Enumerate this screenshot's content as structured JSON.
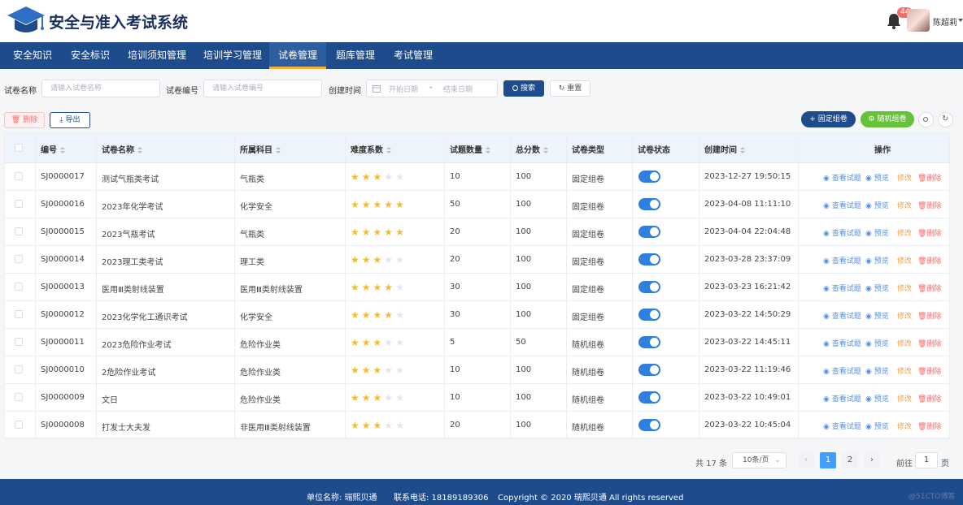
{
  "header": {
    "title": "安全与准入考试系统",
    "notification_count": "44",
    "username": "陈超莉"
  },
  "nav": [
    "安全知识",
    "安全标识",
    "培训须知管理",
    "培训学习管理",
    "试卷管理",
    "题库管理",
    "考试管理"
  ],
  "nav_active": "试卷管理",
  "filters": {
    "name_label": "试卷名称",
    "name_placeholder": "请输入试卷名称",
    "code_label": "试卷编号",
    "code_placeholder": "请输入试卷编号",
    "date_label": "创建时间",
    "start_placeholder": "开始日期",
    "separator": "-",
    "end_placeholder": "结束日期",
    "search": "搜索",
    "reset": "重置"
  },
  "toolbar": {
    "delete": "删除",
    "export": "导出",
    "fixed": "固定组卷",
    "random": "随机组卷"
  },
  "columns": {
    "code": "编号",
    "name": "试卷名称",
    "subject": "所属科目",
    "difficulty": "难度系数",
    "count": "试题数量",
    "score": "总分数",
    "type": "试卷类型",
    "status": "试卷状态",
    "created": "创建时间",
    "ops": "操作"
  },
  "actions": {
    "view": "查看试题",
    "preview": "预览",
    "edit": "修改",
    "delete": "删除"
  },
  "rows": [
    {
      "code": "SJ0000017",
      "name": "测试气瓶类考试",
      "subject": "气瓶类",
      "difficulty": 3,
      "count": "10",
      "score": "100",
      "type": "固定组卷",
      "status": true,
      "created": "2023-12-27 19:50:15"
    },
    {
      "code": "SJ0000016",
      "name": "2023年化学考试",
      "subject": "化学安全",
      "difficulty": 5,
      "count": "50",
      "score": "100",
      "type": "固定组卷",
      "status": true,
      "created": "2023-04-08 11:11:10"
    },
    {
      "code": "SJ0000015",
      "name": "2023气瓶考试",
      "subject": "气瓶类",
      "difficulty": 5,
      "count": "20",
      "score": "100",
      "type": "固定组卷",
      "status": true,
      "created": "2023-04-04 22:04:48"
    },
    {
      "code": "SJ0000014",
      "name": "2023理工类考试",
      "subject": "理工类",
      "difficulty": 3,
      "count": "20",
      "score": "100",
      "type": "固定组卷",
      "status": true,
      "created": "2023-03-28 23:37:09"
    },
    {
      "code": "SJ0000013",
      "name": "医用Ⅲ类射线装置",
      "subject": "医用Ⅲ类射线装置",
      "difficulty": 4,
      "count": "30",
      "score": "100",
      "type": "固定组卷",
      "status": true,
      "created": "2023-03-23 16:21:42"
    },
    {
      "code": "SJ0000012",
      "name": "2023化学化工通识考试",
      "subject": "化学安全",
      "difficulty": 4,
      "count": "30",
      "score": "100",
      "type": "固定组卷",
      "status": true,
      "created": "2023-03-22 14:50:29"
    },
    {
      "code": "SJ0000011",
      "name": "2023危险作业考试",
      "subject": "危险作业类",
      "difficulty": 3,
      "count": "5",
      "score": "50",
      "type": "随机组卷",
      "status": true,
      "created": "2023-03-22 14:45:11"
    },
    {
      "code": "SJ0000010",
      "name": "2危险作业考试",
      "subject": "危险作业类",
      "difficulty": 3,
      "count": "10",
      "score": "100",
      "type": "随机组卷",
      "status": true,
      "created": "2023-03-22 11:19:46"
    },
    {
      "code": "SJ0000009",
      "name": "文日",
      "subject": "危险作业类",
      "difficulty": 3,
      "count": "10",
      "score": "100",
      "type": "随机组卷",
      "status": true,
      "created": "2023-03-22 10:49:01"
    },
    {
      "code": "SJ0000008",
      "name": "打发士大夫发",
      "subject": "非医用Ⅲ类射线装置",
      "difficulty": 3,
      "count": "20",
      "score": "100",
      "type": "随机组卷",
      "status": true,
      "created": "2023-03-22 10:45:04"
    }
  ],
  "pagination": {
    "total": "共 17 条",
    "page_size": "10条/页",
    "pages": [
      "1",
      "2"
    ],
    "current": "1",
    "goto_label": "前往",
    "goto_value": "1",
    "page_suffix": "页"
  },
  "footer": {
    "unit": "单位名称: 瑞熙贝通",
    "phone": "联系电话: 18189189306",
    "copyright": "Copyright © 2020 瑞熙贝通 All rights reserved",
    "watermark": "@51CTO博客"
  },
  "colors": {
    "navy": "#1e4b8c",
    "accent": "#f6b130",
    "switch_on": "#2f7fe0",
    "star": "#f7ba2a",
    "danger": "#f56c6c",
    "success": "#67c23a"
  }
}
